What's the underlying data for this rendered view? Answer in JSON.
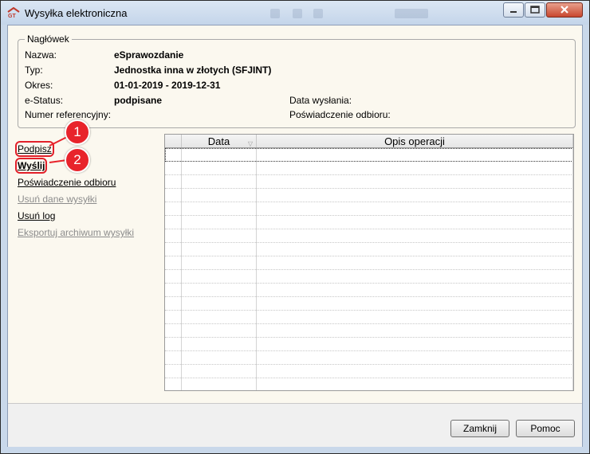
{
  "window": {
    "title": "Wysyłka elektroniczna"
  },
  "header_group": {
    "legend": "Nagłówek",
    "nazwa_label": "Nazwa:",
    "nazwa_value": "eSprawozdanie",
    "typ_label": "Typ:",
    "typ_value": "Jednostka inna w złotych (SFJINT)",
    "okres_label": "Okres:",
    "okres_value": "01-01-2019 - 2019-12-31",
    "estatus_label": "e-Status:",
    "estatus_value": "podpisane",
    "numer_label": "Numer referencyjny:",
    "data_wyslania_label": "Data wysłania:",
    "poswiadczenie_label": "Poświadczenie odbioru:"
  },
  "actions": [
    {
      "label": "Podpisz",
      "enabled": true,
      "bold": false,
      "highlighted": true
    },
    {
      "label": "Wyślij",
      "enabled": true,
      "bold": true,
      "highlighted": true
    },
    {
      "label": "Poświadczenie odbioru",
      "enabled": true,
      "bold": false,
      "highlighted": false
    },
    {
      "label": "Usuń dane wysyłki",
      "enabled": false,
      "bold": false,
      "highlighted": false
    },
    {
      "label": "Usuń log",
      "enabled": true,
      "bold": false,
      "highlighted": false
    },
    {
      "label": "Eksportuj archiwum wysyłki",
      "enabled": false,
      "bold": false,
      "highlighted": false
    }
  ],
  "callouts": {
    "one": "1",
    "two": "2",
    "color": "#e8232b"
  },
  "grid": {
    "columns": [
      "",
      "Data",
      "Opis operacji"
    ],
    "rows": [
      [
        "",
        "",
        ""
      ],
      [
        "",
        "",
        ""
      ],
      [
        "",
        "",
        ""
      ],
      [
        "",
        "",
        ""
      ],
      [
        "",
        "",
        ""
      ],
      [
        "",
        "",
        ""
      ],
      [
        "",
        "",
        ""
      ],
      [
        "",
        "",
        ""
      ],
      [
        "",
        "",
        ""
      ],
      [
        "",
        "",
        ""
      ],
      [
        "",
        "",
        ""
      ],
      [
        "",
        "",
        ""
      ],
      [
        "",
        "",
        ""
      ],
      [
        "",
        "",
        ""
      ],
      [
        "",
        "",
        ""
      ],
      [
        "",
        "",
        ""
      ],
      [
        "",
        "",
        ""
      ],
      [
        "",
        "",
        ""
      ]
    ]
  },
  "buttons": {
    "close": "Zamknij",
    "help": "Pomoc"
  }
}
